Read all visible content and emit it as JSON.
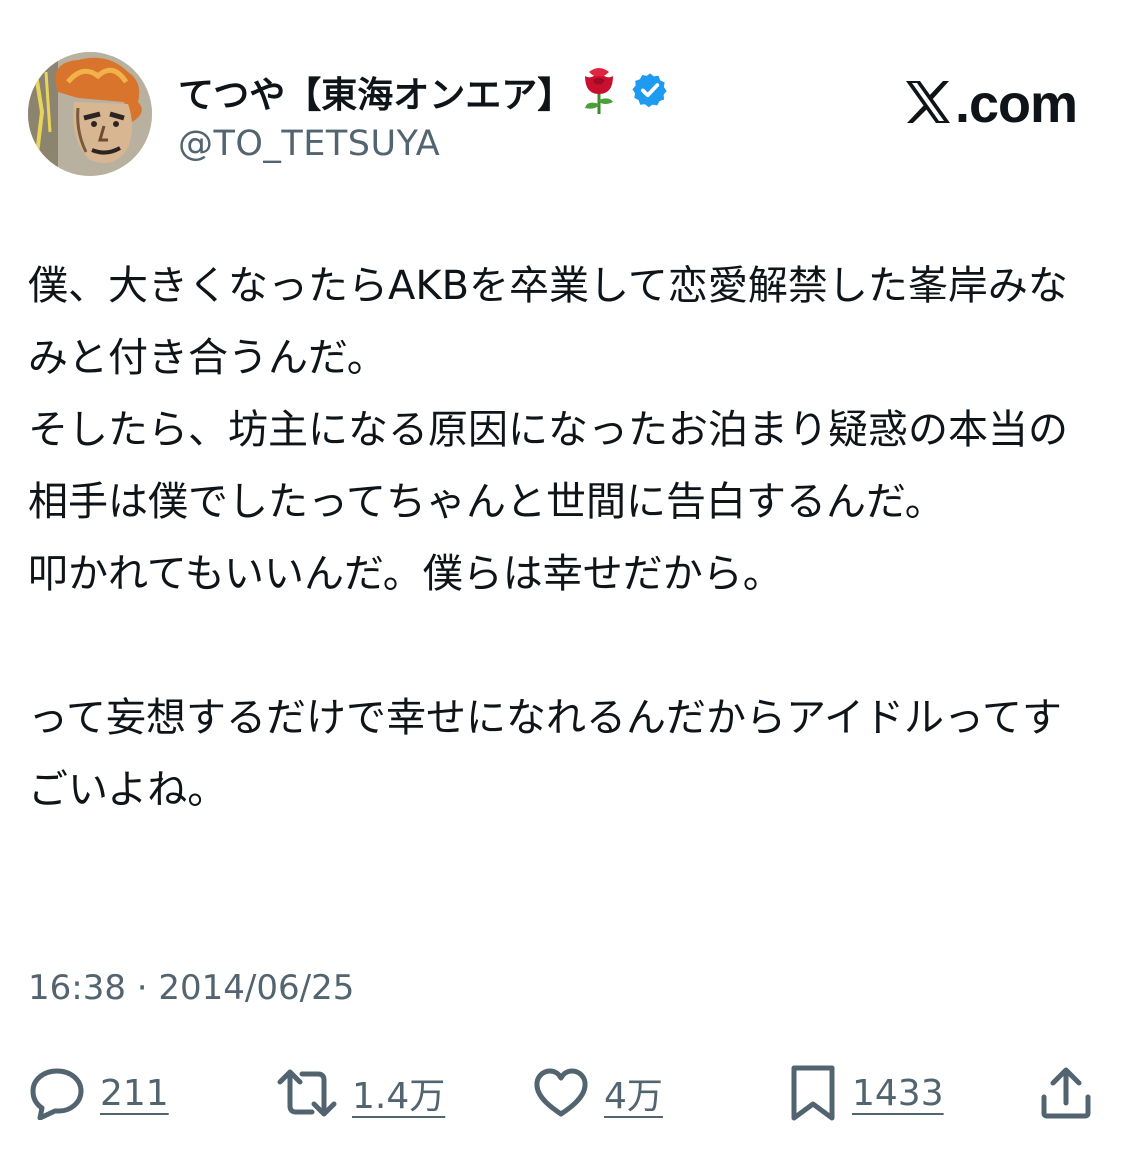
{
  "author": {
    "display_name": "てつや【東海オンエア】",
    "handle": "@TO_TETSUYA",
    "emoji_icon": "rose-icon",
    "verified_icon": "verified-badge-icon",
    "verified_color": "#1d9bf0"
  },
  "brand": {
    "text": ".com",
    "logo_icon": "x-logo-icon"
  },
  "tweet": {
    "text": "僕、大きくなったらAKBを卒業して恋愛解禁した峯岸みなみと付き合うんだ。\nそしたら、坊主になる原因になったお泊まり疑惑の本当の相手は僕でしたってちゃんと世間に告白するんだ。\n叩かれてもいいんだ。僕らは幸せだから。\n\nって妄想するだけで幸せになれるんだからアイドルってすごいよね。",
    "timestamp": "16:38 · 2014/06/25"
  },
  "actions": {
    "reply": {
      "icon": "reply-icon",
      "count": "211"
    },
    "retweet": {
      "icon": "retweet-icon",
      "count": "1.4万"
    },
    "like": {
      "icon": "heart-icon",
      "count": "4万"
    },
    "bookmark": {
      "icon": "bookmark-icon",
      "count": "1433"
    },
    "share": {
      "icon": "share-icon"
    }
  },
  "colors": {
    "text_primary": "#0f1419",
    "text_secondary": "#536471",
    "verified": "#1d9bf0",
    "background": "#ffffff"
  }
}
